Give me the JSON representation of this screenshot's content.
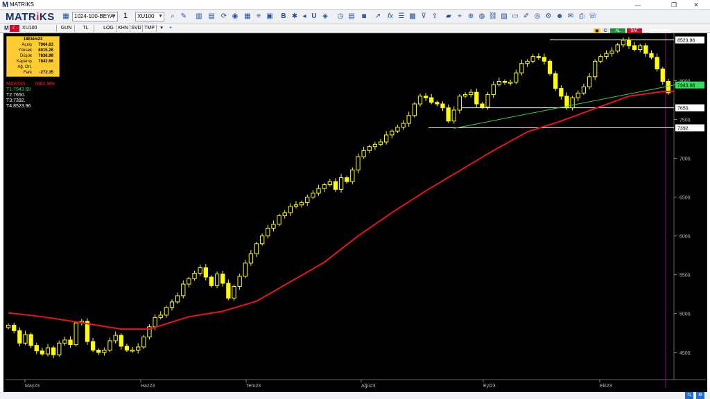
{
  "window": {
    "title": "MATRIKS",
    "minimize": "—",
    "maximize": "❐",
    "close": "✕"
  },
  "toolbar": {
    "logo_prefix": "MATR",
    "logo_mid": "i",
    "logo_suffix": "KS",
    "layout_value": "1024-100-BEYA",
    "count_value": "1",
    "symbol_value": "XU100"
  },
  "subtoolbar": {
    "symbol": "XU100",
    "tabs": [
      "GUN",
      "TL",
      "LOG",
      "KHN",
      "SVD",
      "TMP"
    ]
  },
  "right_header": {
    "c": "C",
    "al": "AL",
    "sat": "SAT",
    "brand": "MATRiKS"
  },
  "info_box": {
    "date": "18Ekim23",
    "rows": [
      {
        "label": "Açılış",
        "value": "7964.63"
      },
      {
        "label": "Yüksek",
        "value": "8015.26"
      },
      {
        "label": "Düşük",
        "value": "7836.99"
      },
      {
        "label": "Kapanış",
        "value": "7842.66"
      },
      {
        "label": "Ağ. Ort.",
        "value": ""
      },
      {
        "label": "Fark",
        "value": "-272.35"
      }
    ]
  },
  "legend": {
    "mav_label": "MAV(50)",
    "mav_value": "7862.969",
    "t1": "T1:7943.68",
    "t2": "T2:7650.",
    "t3": "T3:7392.",
    "t4": "T4:8523.96"
  },
  "colors": {
    "background": "#000000",
    "candle": "#ffff00",
    "mav": "#e8141b",
    "trend": "#34d34a",
    "level": "#ffffff"
  },
  "chart_data": {
    "type": "candlestick",
    "symbol": "XU100",
    "x_labels": [
      "May23",
      "Haz23",
      "Tem23",
      "Ağu23",
      "Eyl23",
      "Eki23"
    ],
    "y_ticks": [
      4500,
      5000,
      5500,
      6000,
      6500,
      7000,
      7500,
      8000
    ],
    "y_tick_labels": [
      "4500.",
      "5000.",
      "5500.",
      "6000.",
      "6500.",
      "7000.",
      "7500.",
      "8000."
    ],
    "ylim": [
      4150,
      8610
    ],
    "levels": [
      {
        "name": "T4",
        "value": 8523.96,
        "label": "8523.96"
      },
      {
        "name": "T2",
        "value": 7650,
        "label": "7650."
      },
      {
        "name": "T3",
        "value": 7392,
        "label": "7392."
      }
    ],
    "last_price": {
      "value": 7943.68,
      "label": "7943.68"
    },
    "trendline": {
      "start": {
        "index": 79,
        "value": 7385
      },
      "end": {
        "index": 118,
        "value": 7960
      }
    },
    "closes": [
      4850,
      4780,
      4620,
      4730,
      4590,
      4520,
      4480,
      4560,
      4470,
      4620,
      4660,
      4600,
      4880,
      4900,
      4640,
      4530,
      4500,
      4530,
      4650,
      4720,
      4580,
      4530,
      4530,
      4570,
      4700,
      4830,
      4950,
      4980,
      5080,
      5150,
      5230,
      5380,
      5450,
      5520,
      5590,
      5470,
      5360,
      5510,
      5390,
      5200,
      5350,
      5480,
      5650,
      5770,
      5900,
      6000,
      6100,
      6150,
      6260,
      6300,
      6380,
      6400,
      6430,
      6500,
      6550,
      6610,
      6660,
      6700,
      6600,
      6750,
      6700,
      6850,
      7020,
      7100,
      7150,
      7180,
      7210,
      7300,
      7350,
      7400,
      7450,
      7550,
      7700,
      7800,
      7780,
      7720,
      7700,
      7650,
      7480,
      7620,
      7800,
      7820,
      7850,
      7700,
      7660,
      7820,
      7950,
      7990,
      7980,
      7980,
      8100,
      8220,
      8250,
      8310,
      8300,
      8250,
      8090,
      7900,
      7800,
      7650,
      7780,
      7840,
      7920,
      8050,
      8250,
      8310,
      8350,
      8380,
      8460,
      8520,
      8450,
      8400,
      8450,
      8350,
      8300,
      8150,
      7990,
      7842.66
    ],
    "mav50": [
      {
        "index": 0,
        "value": 5010
      },
      {
        "index": 6,
        "value": 4960
      },
      {
        "index": 14,
        "value": 4870
      },
      {
        "index": 20,
        "value": 4800
      },
      {
        "index": 25,
        "value": 4800
      },
      {
        "index": 32,
        "value": 4960
      },
      {
        "index": 38,
        "value": 5030
      },
      {
        "index": 44,
        "value": 5160
      },
      {
        "index": 50,
        "value": 5410
      },
      {
        "index": 56,
        "value": 5660
      },
      {
        "index": 62,
        "value": 6000
      },
      {
        "index": 68,
        "value": 6300
      },
      {
        "index": 74,
        "value": 6580
      },
      {
        "index": 80,
        "value": 6840
      },
      {
        "index": 86,
        "value": 7100
      },
      {
        "index": 92,
        "value": 7340
      },
      {
        "index": 98,
        "value": 7480
      },
      {
        "index": 104,
        "value": 7640
      },
      {
        "index": 110,
        "value": 7800
      },
      {
        "index": 116,
        "value": 7860
      },
      {
        "index": 118,
        "value": 7862.969
      }
    ]
  }
}
